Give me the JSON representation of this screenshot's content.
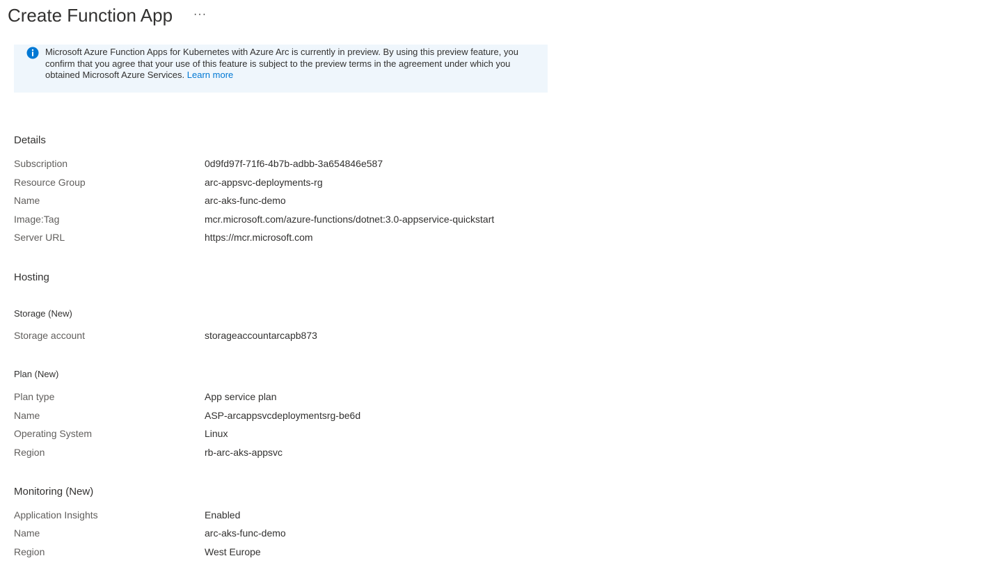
{
  "header": {
    "title": "Create Function App",
    "more_label": "···"
  },
  "banner": {
    "icon": "info-icon",
    "message": "Microsoft Azure Function Apps for Kubernetes with Azure Arc is currently in preview. By using this preview feature, you confirm that you agree that your use of this feature is subject to the preview terms in the agreement under which you obtained Microsoft Azure Services.",
    "link_label": "Learn more"
  },
  "details": {
    "heading": "Details",
    "rows": [
      {
        "label": "Subscription",
        "value": "0d9fd97f-71f6-4b7b-adbb-3a654846e587"
      },
      {
        "label": "Resource Group",
        "value": "arc-appsvc-deployments-rg"
      },
      {
        "label": "Name",
        "value": "arc-aks-func-demo"
      },
      {
        "label": "Image:Tag",
        "value": "mcr.microsoft.com/azure-functions/dotnet:3.0-appservice-quickstart"
      },
      {
        "label": "Server URL",
        "value": "https://mcr.microsoft.com"
      }
    ]
  },
  "hosting": {
    "heading": "Hosting",
    "storage": {
      "heading": "Storage (New)",
      "rows": [
        {
          "label": "Storage account",
          "value": "storageaccountarcapb873"
        }
      ]
    },
    "plan": {
      "heading": "Plan (New)",
      "rows": [
        {
          "label": "Plan type",
          "value": "App service plan"
        },
        {
          "label": "Name",
          "value": "ASP-arcappsvcdeploymentsrg-be6d"
        },
        {
          "label": "Operating System",
          "value": "Linux"
        },
        {
          "label": "Region",
          "value": "rb-arc-aks-appsvc"
        }
      ]
    }
  },
  "monitoring": {
    "heading": "Monitoring (New)",
    "rows": [
      {
        "label": "Application Insights",
        "value": "Enabled"
      },
      {
        "label": "Name",
        "value": "arc-aks-func-demo"
      },
      {
        "label": "Region",
        "value": "West Europe"
      }
    ]
  },
  "colors": {
    "accent": "#0078d4",
    "banner_bg": "#eff6fc",
    "text": "#323130",
    "label_text": "#605e5c"
  }
}
